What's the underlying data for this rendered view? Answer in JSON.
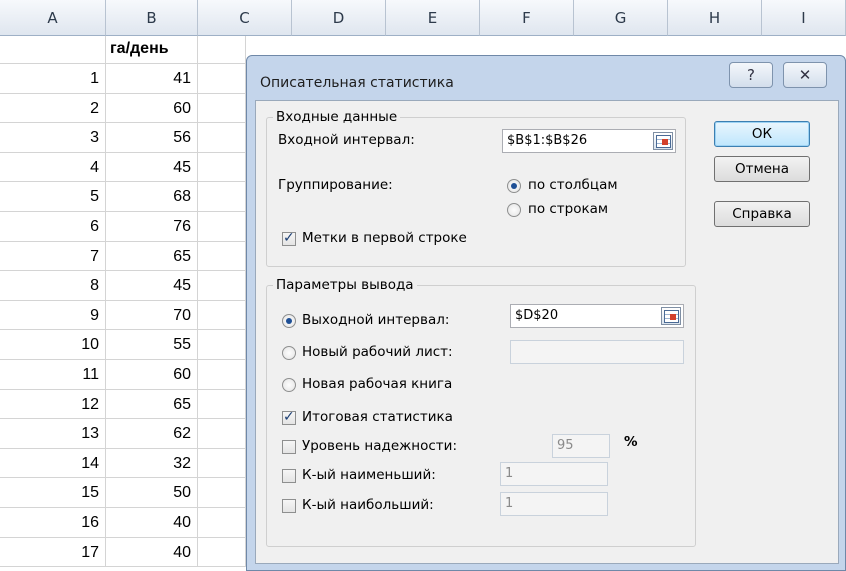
{
  "spreadsheet": {
    "columns": [
      "A",
      "B",
      "C",
      "D",
      "E",
      "F",
      "G",
      "H",
      "I"
    ],
    "b1_header": "га/день",
    "rows": [
      {
        "a": "1",
        "b": "41"
      },
      {
        "a": "2",
        "b": "60"
      },
      {
        "a": "3",
        "b": "56"
      },
      {
        "a": "4",
        "b": "45"
      },
      {
        "a": "5",
        "b": "68"
      },
      {
        "a": "6",
        "b": "76"
      },
      {
        "a": "7",
        "b": "65"
      },
      {
        "a": "8",
        "b": "45"
      },
      {
        "a": "9",
        "b": "70"
      },
      {
        "a": "10",
        "b": "55"
      },
      {
        "a": "11",
        "b": "60"
      },
      {
        "a": "12",
        "b": "65"
      },
      {
        "a": "13",
        "b": "62"
      },
      {
        "a": "14",
        "b": "32"
      },
      {
        "a": "15",
        "b": "50"
      },
      {
        "a": "16",
        "b": "40"
      },
      {
        "a": "17",
        "b": "40"
      }
    ]
  },
  "dialog": {
    "title": "Описательная статистика",
    "help_glyph": "?",
    "close_glyph": "✕",
    "input": {
      "group_label": "Входные данные",
      "range_label": "Входной интервал:",
      "range_value": "$B$1:$B$26",
      "grouping_label": "Группирование:",
      "by_columns": "по столбцам",
      "by_rows": "по строкам",
      "labels_first_row": "Метки в первой строке"
    },
    "output": {
      "group_label": "Параметры вывода",
      "output_range_label": "Выходной интервал:",
      "output_range_value": "$D$20",
      "new_sheet_label": "Новый рабочий лист:",
      "new_workbook_label": "Новая рабочая книга",
      "summary_label": "Итоговая статистика",
      "confidence_label": "Уровень надежности:",
      "confidence_value": "95",
      "percent": "%",
      "kth_smallest_label": "К-ый наименьший:",
      "kth_smallest_value": "1",
      "kth_largest_label": "К-ый наибольший:",
      "kth_largest_value": "1"
    },
    "buttons": {
      "ok": "ОК",
      "cancel": "Отмена",
      "help": "Справка"
    }
  }
}
